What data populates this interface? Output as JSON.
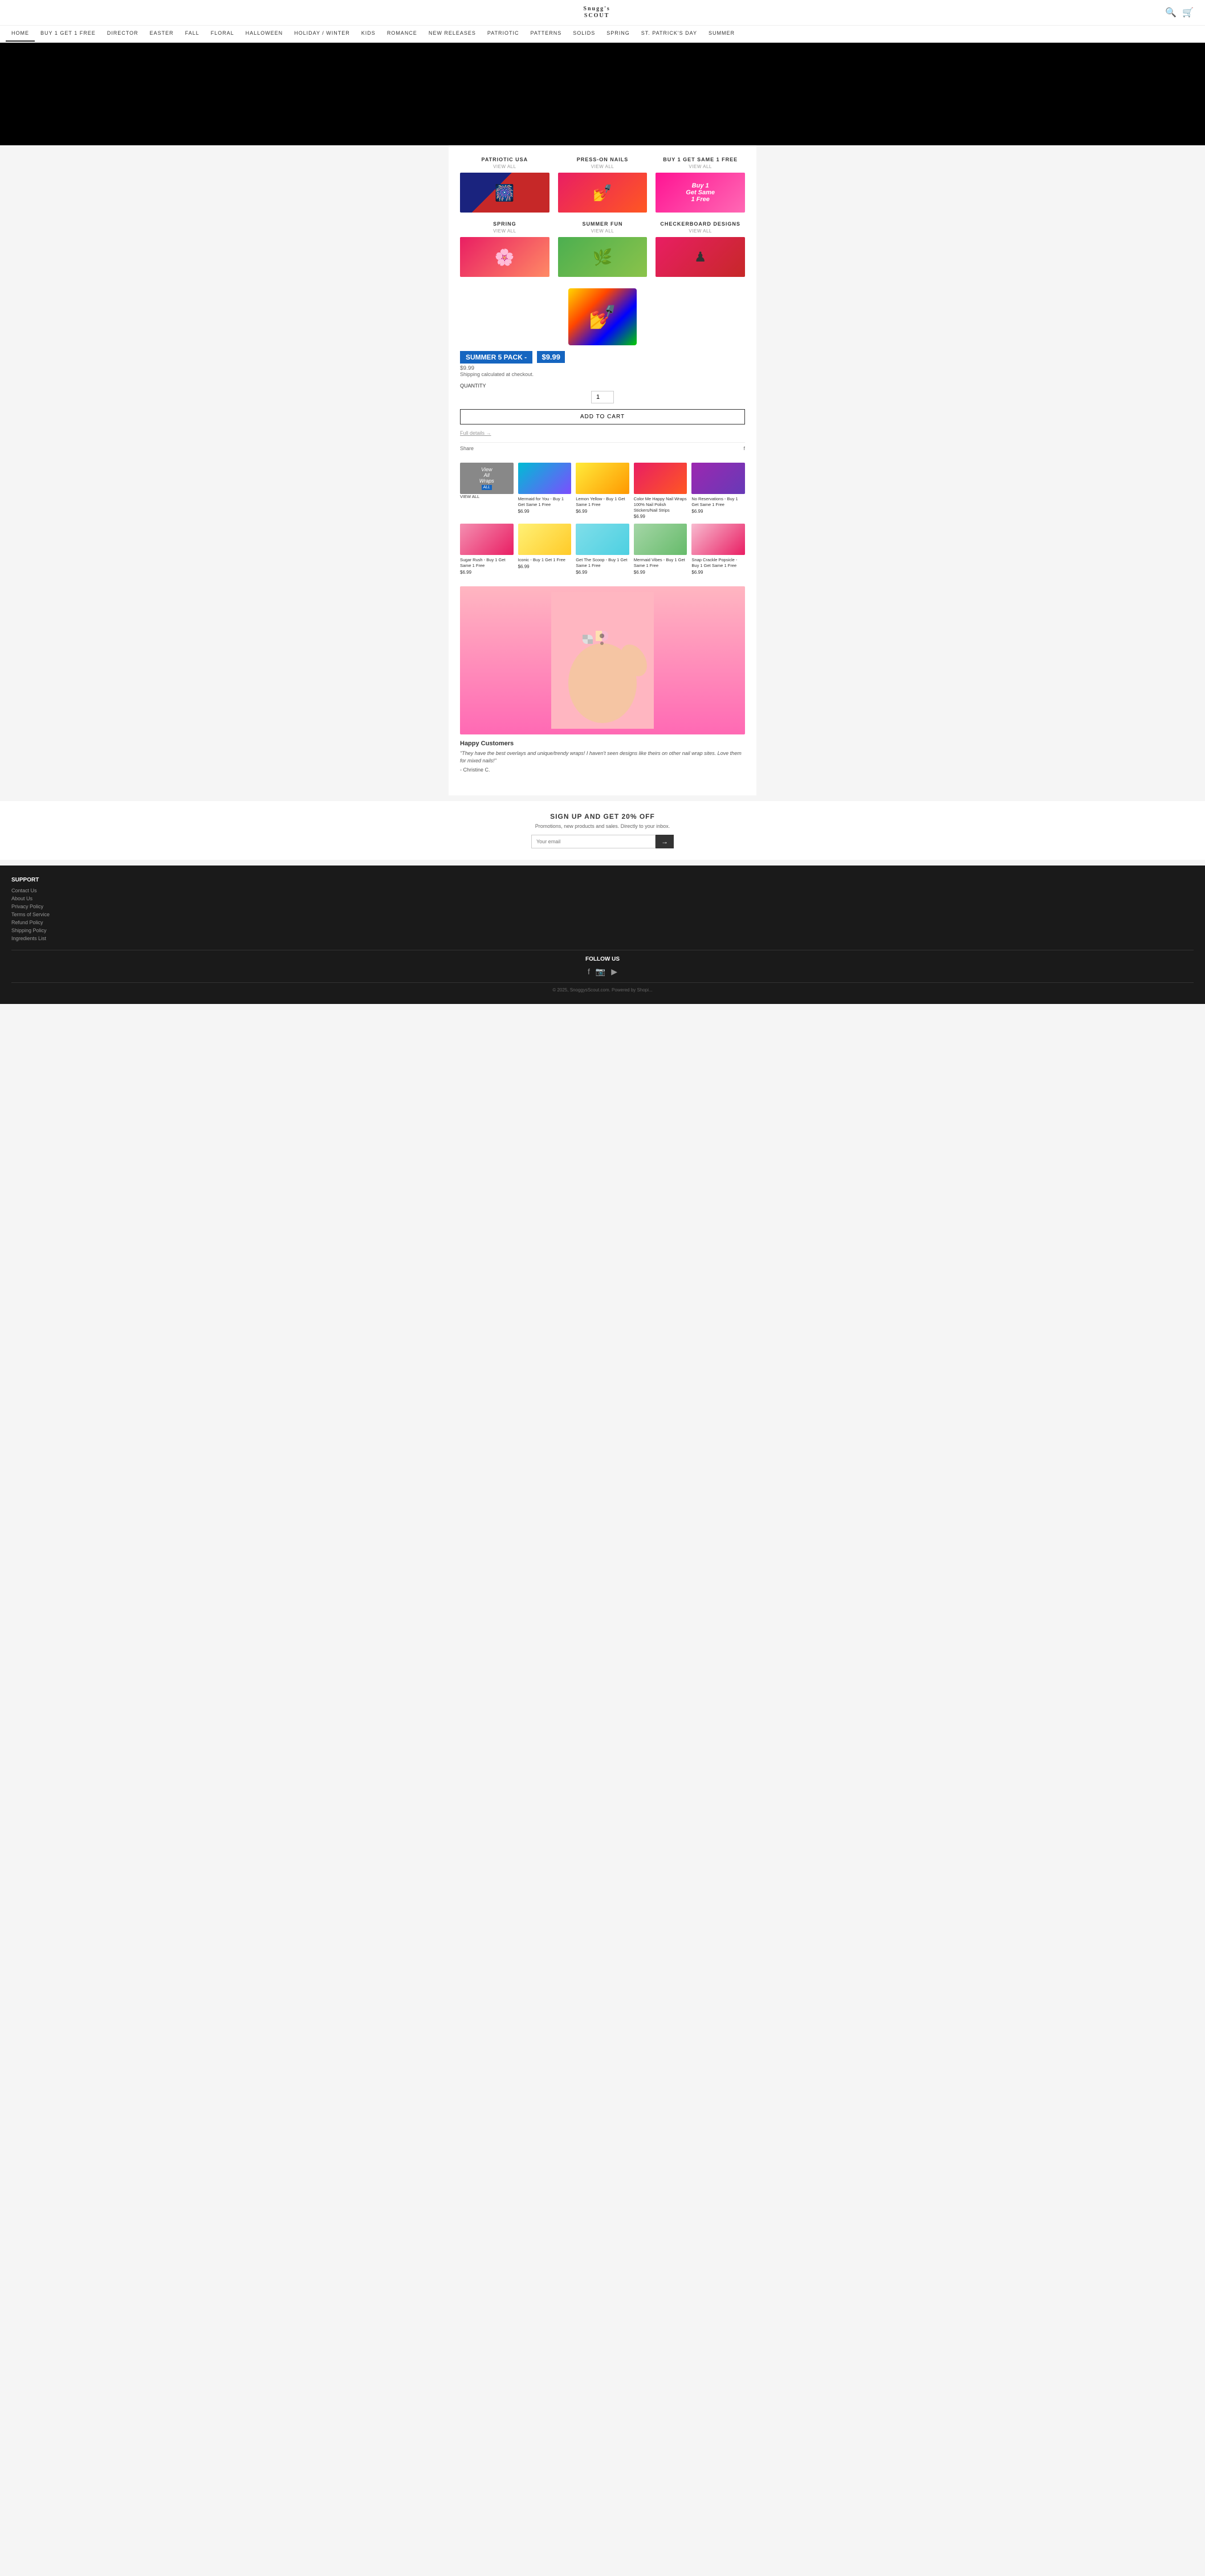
{
  "site": {
    "logo_line1": "Snugg's",
    "logo_line2": "SCOUT"
  },
  "nav": {
    "items": [
      {
        "label": "HOME",
        "active": true
      },
      {
        "label": "BUY 1 GET 1 FREE",
        "active": false
      },
      {
        "label": "DIRECTOR",
        "active": false
      },
      {
        "label": "EASTER",
        "active": false
      },
      {
        "label": "FALL",
        "active": false
      },
      {
        "label": "FLORAL",
        "active": false
      },
      {
        "label": "HALLOWEEN",
        "active": false
      },
      {
        "label": "HOLIDAY / WINTER",
        "active": false
      },
      {
        "label": "KIDS",
        "active": false
      },
      {
        "label": "ROMANCE",
        "active": false
      },
      {
        "label": "NEW RELEASES",
        "active": false
      },
      {
        "label": "PATRIOTIC",
        "active": false
      },
      {
        "label": "PATTERNS",
        "active": false
      },
      {
        "label": "SOLIDS",
        "active": false
      },
      {
        "label": "SPRING",
        "active": false
      },
      {
        "label": "ST. PATRICK'S DAY",
        "active": false
      },
      {
        "label": "SUMMER",
        "active": false
      }
    ]
  },
  "categories": [
    {
      "title": "PATRIOTIC USA",
      "subtitle": "VIEW ALL",
      "icon": "🇺🇸"
    },
    {
      "title": "PRESS-ON NAILS",
      "subtitle": "VIEW ALL",
      "icon": "💅"
    },
    {
      "title": "BUY 1 GET SAME 1 FREE",
      "subtitle": "VIEW ALL",
      "text": "Buy 1\nGet Same\n1 Free"
    },
    {
      "title": "SPRING",
      "subtitle": "VIEW ALL",
      "icon": "🌸"
    },
    {
      "title": "SUMMER FUN",
      "subtitle": "VIEW ALL",
      "icon": "🌿"
    },
    {
      "title": "CHECKERBOARD DESIGNS",
      "subtitle": "VIEW ALL",
      "icon": "♟"
    }
  ],
  "featured_product": {
    "title": "SUMMER 5 PACK -",
    "price": "$9.99",
    "price_regular": "$9.99",
    "shipping": "Shipping calculated at checkout.",
    "quantity_label": "QUANTITY",
    "quantity_value": "1",
    "add_to_cart": "ADD TO CART",
    "full_details": "Full details →",
    "share_label": "Share",
    "facebook_icon": "f"
  },
  "products_header": {
    "view_all_text": "View\nAll\nWraps",
    "view_all_badge": "ALL",
    "view_all_sub": "VIEW ALL"
  },
  "products": [
    {
      "name": "Mermaid for You - Buy 1 Get Same 1 Free",
      "price": "$6.99",
      "color_class": "prod-mermaid"
    },
    {
      "name": "Lemon Yellow - Buy 1 Get Same 1 Free",
      "price": "$6.99",
      "color_class": "prod-lemon"
    },
    {
      "name": "Color Me Happy Nail Wraps 100% Nail Polish Stickers/Nail Strips",
      "price": "$6.99",
      "color_class": "prod-colorhappy"
    },
    {
      "name": "No Reservations - Buy 1 Get Same 1 Free",
      "price": "$6.99",
      "color_class": "prod-reservations"
    },
    {
      "name": "Sugar Rush - Buy 1 Get Same 1 Free",
      "price": "$6.99",
      "color_class": "prod-sugar"
    },
    {
      "name": "Iconic - Buy 1 Get 1 Free",
      "price": "$6.99",
      "color_class": "prod-iconic"
    },
    {
      "name": "Get The Scoop - Buy 1 Get Same 1 Free",
      "price": "$6.99",
      "color_class": "prod-scoop"
    },
    {
      "name": "Mermaid Vibes - Buy 1 Get Same 1 Free",
      "price": "$6.99",
      "color_class": "prod-vibes"
    },
    {
      "name": "Snap Crackle Popsicle - Buy 1 Get Same 1 Free",
      "price": "$6.99",
      "color_class": "prod-snap"
    }
  ],
  "happy_customers": {
    "section_title": "Happy Customers",
    "quote": "\"They have the best overlays and unique/trendy wraps! I haven't seen designs like theirs on other nail wrap sites. Love them for mixed nails!\"",
    "author": "- Christine C."
  },
  "email_signup": {
    "title": "SIGN UP AND GET 20% OFF",
    "subtitle": "Promotions, new products and sales. Directly to your inbox.",
    "placeholder": "Your email",
    "button_text": "→"
  },
  "footer": {
    "support_title": "SUPPORT",
    "links": [
      "Contact Us",
      "About Us",
      "Privacy Policy",
      "Terms of Service",
      "Refund Policy",
      "Shipping Policy",
      "Ingredients List"
    ],
    "follow_title": "FOLLOW US",
    "copyright": "© 2025, SnoggysScout.com. Powered by Shopi..."
  }
}
